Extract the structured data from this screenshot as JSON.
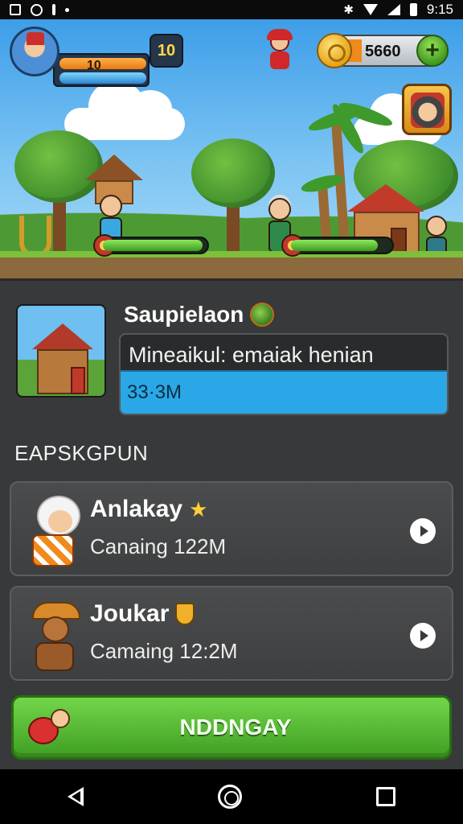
{
  "status_bar": {
    "time": "9:15",
    "icons": [
      "notification-icon",
      "sync-icon",
      "alert-icon",
      "dot-icon",
      "bluetooth-icon",
      "wifi-icon",
      "signal-icon",
      "battery-icon"
    ]
  },
  "hud": {
    "player_avatar": "player-avatar",
    "hp_value": "10",
    "level": "10",
    "coins": "5660",
    "add_icon": "+"
  },
  "selected": {
    "title": "Saupielaon",
    "description": "Mineaikul: emaiak henian",
    "value": "33·3M"
  },
  "section": {
    "label": "EAPSKGPUN"
  },
  "cards": [
    {
      "name": "Anlakay",
      "subtitle": "Canaing 122M",
      "badge_icon": "star-icon"
    },
    {
      "name": "Joukar",
      "subtitle": "Camaing 12:2M",
      "badge_icon": "shield-icon"
    }
  ],
  "cta": {
    "label": "NDDNGAY"
  },
  "colors": {
    "panel": "#38393a",
    "accent_blue": "#2aa7e6",
    "cta_green": "#4fb82b",
    "coin_gold": "#e6a317"
  }
}
